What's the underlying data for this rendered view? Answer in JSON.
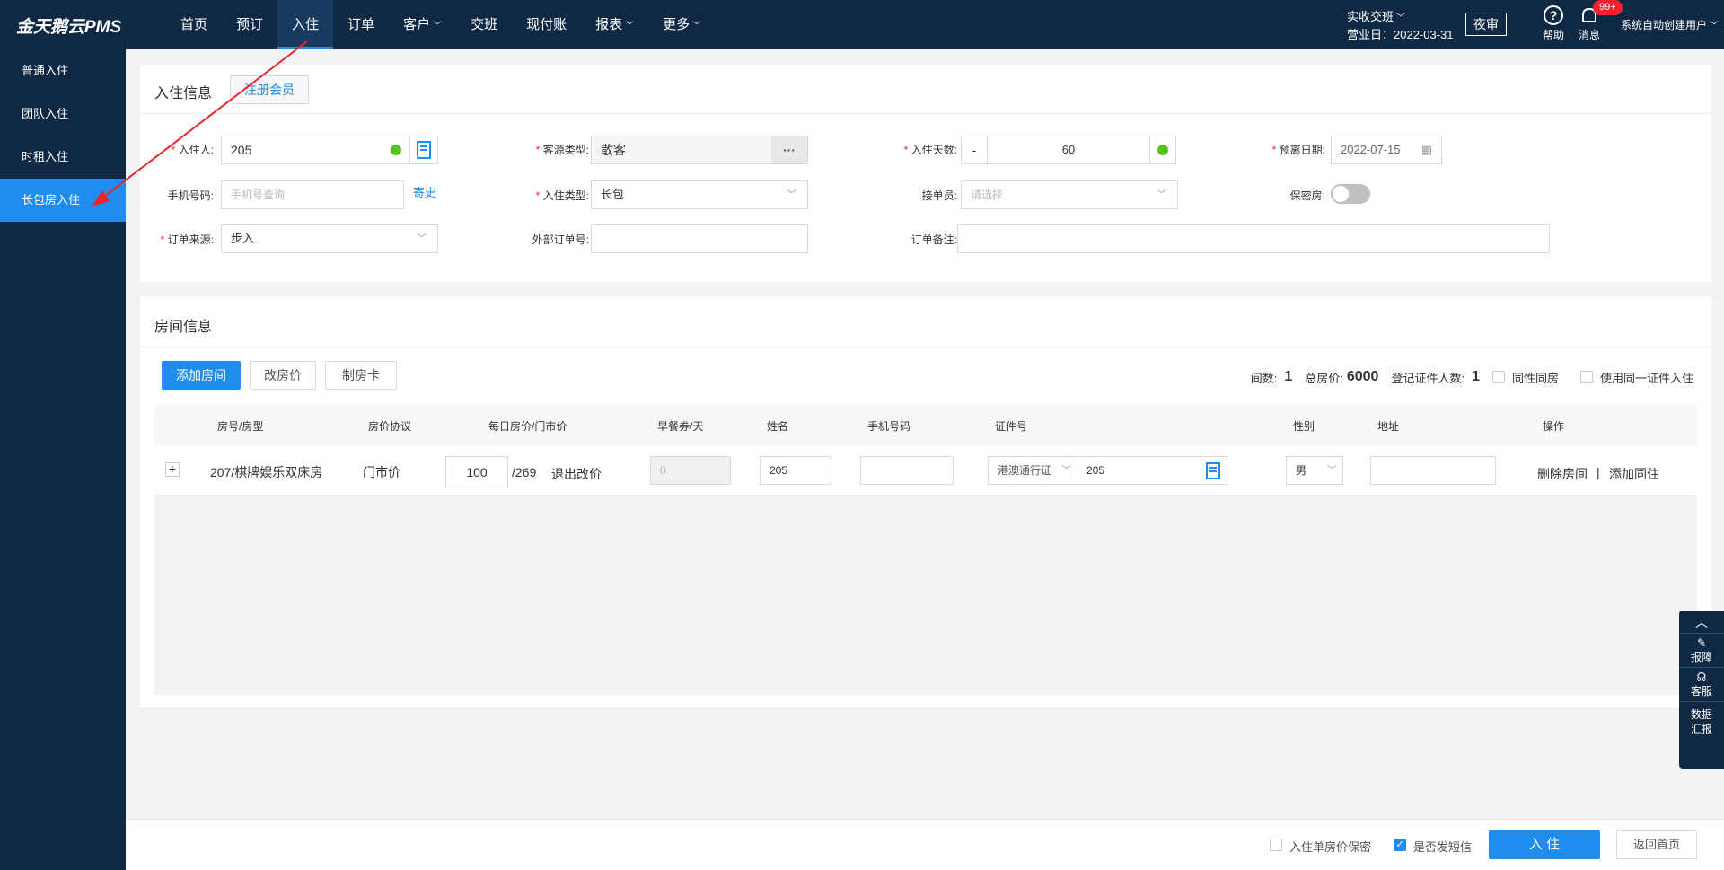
{
  "app": {
    "logo": "金天鹅云PMS"
  },
  "nav": {
    "items": [
      {
        "label": "首页"
      },
      {
        "label": "预订"
      },
      {
        "label": "入住"
      },
      {
        "label": "订单"
      },
      {
        "label": "客户"
      },
      {
        "label": "交班"
      },
      {
        "label": "现付账"
      },
      {
        "label": "报表"
      },
      {
        "label": "更多"
      }
    ],
    "shift": "实收交班",
    "business_day": "营业日：2022-03-31",
    "night_audit": "夜审",
    "help": "帮助",
    "message": "消息",
    "message_badge": "99+",
    "user": "系统自动创建用户"
  },
  "sidebar": {
    "items": [
      {
        "label": "普通入住"
      },
      {
        "label": "团队入住"
      },
      {
        "label": "时租入住"
      },
      {
        "label": "长包房入住"
      }
    ]
  },
  "checkin_info": {
    "title": "入住信息",
    "register_member": "注册会员",
    "guest_label": "入住人:",
    "guest_value": "205",
    "source_type_label": "客源类型:",
    "source_type_value": "散客",
    "days_label": "入住天数:",
    "days_minus": "-",
    "days_value": "60",
    "depart_label": "预离日期:",
    "depart_value": "2022-07-15",
    "phone_label": "手机号码:",
    "phone_placeholder": "手机号查询",
    "sent_history": "寄史",
    "checkin_type_label": "入住类型:",
    "checkin_type_value": "长包",
    "receptionist_label": "接单员:",
    "receptionist_placeholder": "请选择",
    "secret_room_label": "保密房:",
    "order_source_label": "订单来源:",
    "order_source_value": "步入",
    "external_order_label": "外部订单号:",
    "order_note_label": "订单备注:"
  },
  "room_info": {
    "title": "房间信息",
    "add_room": "添加房间",
    "change_price": "改房价",
    "make_card": "制房卡",
    "rooms_label": "间数:",
    "rooms_value": "1",
    "total_price_label": "总房价:",
    "total_price_value": "6000",
    "registered_label": "登记证件人数:",
    "registered_value": "1",
    "same_sex": "同性同房",
    "same_id": "使用同一证件入住",
    "headers": [
      "房号/房型",
      "房价协议",
      "每日房价/门市价",
      "早餐券/天",
      "姓名",
      "手机号码",
      "证件号",
      "性别",
      "地址",
      "操作"
    ],
    "row": {
      "expand": "+",
      "room": "207/棋牌娱乐双床房",
      "agreement": "门市价",
      "daily_price": "100",
      "rack_price": "/269",
      "exit_change": "退出改价",
      "breakfast": "0",
      "name": "205",
      "phone": "",
      "id_type": "港澳通行证",
      "id_number": "205",
      "gender": "男",
      "address": "",
      "delete": "删除房间",
      "sep": "|",
      "add_cohabitant": "添加同住"
    }
  },
  "footer": {
    "price_secret": "入住单房价保密",
    "send_sms": "是否发短信",
    "checkin": "入 住",
    "back_home": "返回首页"
  },
  "float_panel": {
    "report": "报障",
    "service": "客服",
    "data_line1": "数据",
    "data_line2": "汇报"
  }
}
